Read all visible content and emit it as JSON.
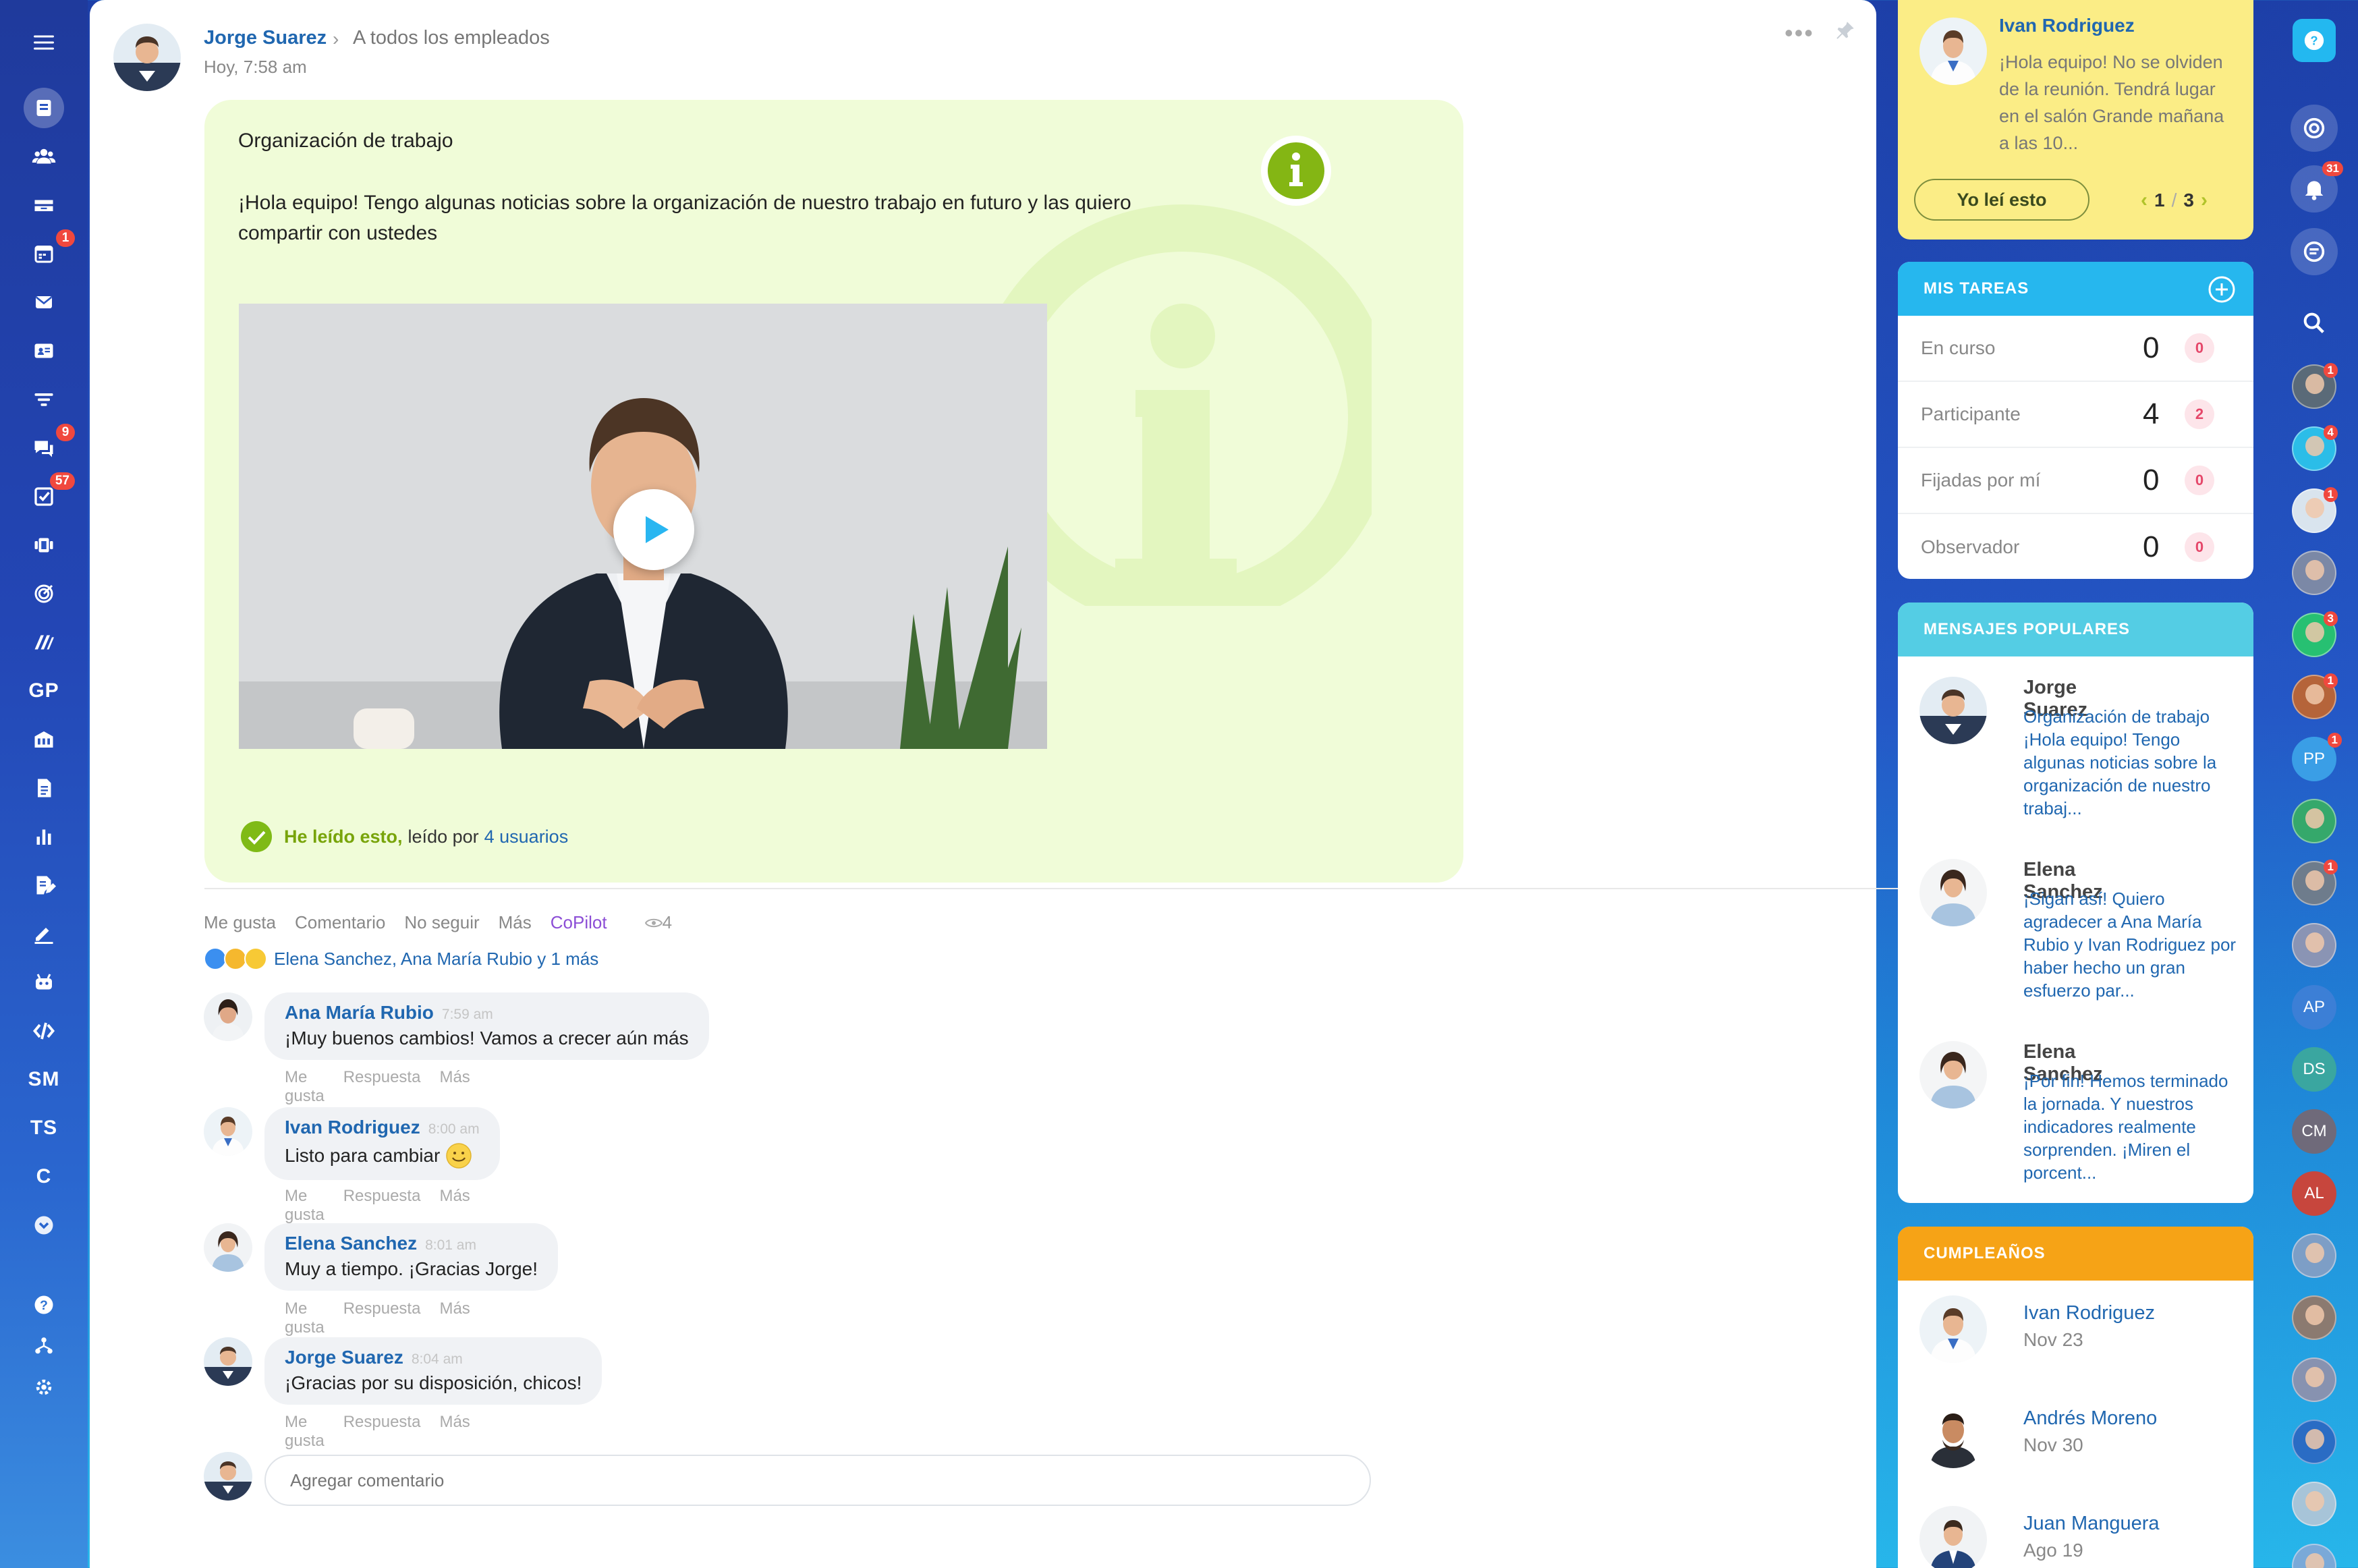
{
  "left_sidebar": {
    "items": [
      {
        "name": "menu-icon",
        "badge": ""
      },
      {
        "name": "feed-icon",
        "badge": ""
      },
      {
        "name": "employees-icon",
        "badge": ""
      },
      {
        "name": "inbox-icon",
        "badge": ""
      },
      {
        "name": "calendar-icon",
        "badge": "1"
      },
      {
        "name": "mail-icon",
        "badge": ""
      },
      {
        "name": "contacts-card-icon",
        "badge": ""
      },
      {
        "name": "filter-icon",
        "badge": ""
      },
      {
        "name": "chat-icon",
        "badge": "9"
      },
      {
        "name": "tasks-icon",
        "badge": "57"
      },
      {
        "name": "kanban-icon",
        "badge": ""
      },
      {
        "name": "goals-icon",
        "badge": ""
      },
      {
        "name": "brand-icon",
        "badge": ""
      }
    ],
    "text_items": [
      "GP",
      "SM",
      "TS",
      "C"
    ]
  },
  "post": {
    "author": "Jorge Suarez",
    "audience": "A todos los empleados",
    "time": "Hoy, 7:58 am",
    "title": "Organización de trabajo",
    "body": "¡Hola equipo! Tengo algunas noticias sobre la organización de nuestro trabajo en futuro y las quiero compartir con ustedes",
    "read_label": "He leído esto,",
    "read_by": "leído por",
    "read_users": "4 usuarios",
    "actions": {
      "like": "Me gusta",
      "comment": "Comentario",
      "unfollow": "No seguir",
      "more": "Más",
      "copilot": "CoPilot",
      "views": "4"
    },
    "reactions_text": "Elena Sanchez, Ana María Rubio y 1 más",
    "accent_color": "#78a40a"
  },
  "comments": [
    {
      "author": "Ana María Rubio",
      "time": "7:59 am",
      "text": "¡Muy buenos cambios! Vamos a crecer aún más"
    },
    {
      "author": "Ivan Rodriguez",
      "time": "8:00 am",
      "text": "Listo para cambiar"
    },
    {
      "author": "Elena Sanchez",
      "time": "8:01 am",
      "text": "Muy a tiempo. ¡Gracias Jorge!"
    },
    {
      "author": "Jorge Suarez",
      "time": "8:04 am",
      "text": "¡Gracias por su disposición, chicos!"
    }
  ],
  "comment_actions": {
    "like": "Me gusta",
    "reply": "Respuesta",
    "more": "Más"
  },
  "add_comment_placeholder": "Agregar comentario",
  "notice": {
    "author": "Ivan Rodriguez",
    "text": "¡Hola equipo! No se olviden de la reunión. Tendrá lugar en el salón Grande mañana a las 10...",
    "button": "Yo leí esto",
    "page": "1",
    "sep": "/",
    "total": "3"
  },
  "tasks": {
    "title": "MIS TAREAS",
    "rows": [
      {
        "label": "En curso",
        "count": "0",
        "badge": "0"
      },
      {
        "label": "Participante",
        "count": "4",
        "badge": "2"
      },
      {
        "label": "Fijadas por mí",
        "count": "0",
        "badge": "0"
      },
      {
        "label": "Observador",
        "count": "0",
        "badge": "0"
      }
    ]
  },
  "popular": {
    "title": "MENSAJES POPULARES",
    "items": [
      {
        "author": "Jorge Suarez",
        "text": "Organización de trabajo ¡Hola equipo! Tengo algunas noticias sobre la organización de nuestro trabaj..."
      },
      {
        "author": "Elena Sanchez",
        "text": "¡Sigan así! Quiero agradecer a Ana María Rubio y Ivan Rodriguez por haber hecho un gran esfuerzo par..."
      },
      {
        "author": "Elena Sanchez",
        "text": "¡Por fin! Hemos terminado la jornada. Y nuestros indicadores realmente sorprenden. ¡Miren el porcent..."
      }
    ]
  },
  "birthdays": {
    "title": "CUMPLEAÑOS",
    "items": [
      {
        "name": "Ivan Rodriguez",
        "date": "Nov 23"
      },
      {
        "name": "Andrés Moreno",
        "date": "Nov 30"
      },
      {
        "name": "Juan Manguera",
        "date": "Ago 19"
      }
    ]
  },
  "right_bar": {
    "notifications_badge": "31",
    "avatars": [
      {
        "type": "photo",
        "color": "#5a6a78",
        "badge": "1"
      },
      {
        "type": "photo",
        "color": "#2bbde8",
        "badge": "4"
      },
      {
        "type": "photo",
        "color": "#d9e4ee",
        "badge": "1"
      },
      {
        "type": "photo",
        "color": "#7b88a6",
        "badge": ""
      },
      {
        "type": "photo",
        "color": "#27c072",
        "badge": "3"
      },
      {
        "type": "photo",
        "color": "#b5643a",
        "badge": "1"
      },
      {
        "type": "initials",
        "initials": "PP",
        "color": "#3a9ee6",
        "badge": "1"
      },
      {
        "type": "photo",
        "color": "#35a86b",
        "badge": ""
      },
      {
        "type": "photo",
        "color": "#6e7c8c",
        "badge": "1"
      },
      {
        "type": "photo",
        "color": "#8a94b4",
        "badge": ""
      },
      {
        "type": "initials",
        "initials": "AP",
        "color": "#3c7fd6",
        "badge": ""
      },
      {
        "type": "initials",
        "initials": "DS",
        "color": "#3aa6a0",
        "badge": ""
      },
      {
        "type": "initials",
        "initials": "CM",
        "color": "#6f6a7a",
        "badge": ""
      },
      {
        "type": "initials",
        "initials": "AL",
        "color": "#c7463d",
        "badge": ""
      },
      {
        "type": "photo",
        "color": "#7d9ec6",
        "badge": ""
      },
      {
        "type": "photo",
        "color": "#8b7a70",
        "badge": ""
      },
      {
        "type": "photo",
        "color": "#8792b0",
        "badge": ""
      },
      {
        "type": "photo",
        "color": "#2a6cc4",
        "badge": ""
      },
      {
        "type": "photo",
        "color": "#a7c4d8",
        "badge": ""
      },
      {
        "type": "photo",
        "color": "#7aa9d8",
        "badge": ""
      }
    ]
  }
}
